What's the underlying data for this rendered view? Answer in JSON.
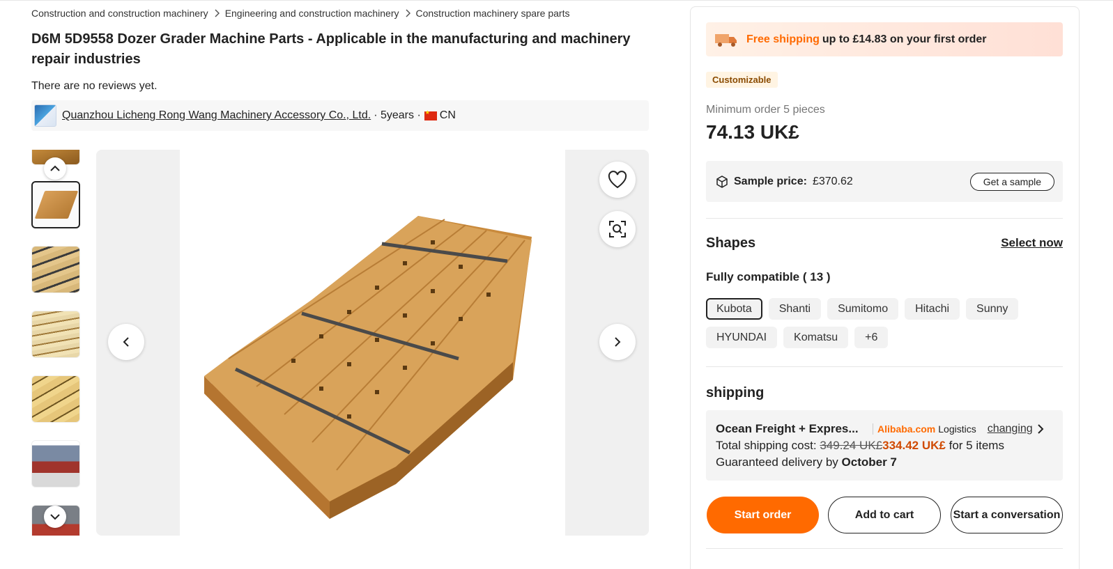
{
  "breadcrumb": {
    "items": [
      "Construction and construction machinery",
      "Engineering and construction machinery",
      "Construction machinery spare parts"
    ]
  },
  "product": {
    "title": "D6M 5D9558 Dozer Grader Machine Parts - Applicable in the manufacturing and machinery repair industries",
    "reviews": "There are no reviews yet."
  },
  "supplier": {
    "name": "Quanzhou Licheng Rong Wang Machinery Accessory Co., Ltd.",
    "years": "· 5years ·",
    "country": "CN"
  },
  "gallery": {
    "thumbnail_count": 7,
    "active_index": 1
  },
  "panel": {
    "banner_highlight": "Free shipping",
    "banner_text": "up to £14.83 on your first order",
    "badge": "Customizable",
    "min_order": "Minimum order 5 pieces",
    "price": "74.13 UK£",
    "sample_label": "Sample price:",
    "sample_price": "£370.62",
    "sample_button": "Get a sample",
    "shapes_heading": "Shapes",
    "select_now": "Select now",
    "compat_heading": "Fully compatible ( 13 )",
    "chips": [
      "Kubota",
      "Shanti",
      "Sumitomo",
      "Hitachi",
      "Sunny",
      "HYUNDAI",
      "Komatsu",
      "+6"
    ],
    "selected_chip": "Kubota",
    "shipping_heading": "shipping",
    "shipping": {
      "method": "Ocean Freight + Expres...",
      "brand_ali": "Alibaba.com",
      "brand_logistics": "Logistics",
      "changing": "changing",
      "cost_label": "Total shipping cost:",
      "old_cost": "349.24 UK£",
      "new_cost": "334.42 UK£",
      "items": "for 5 items",
      "delivery_label": "Guaranteed delivery by",
      "delivery_date": "October 7"
    },
    "buttons": {
      "start_order": "Start order",
      "add_to_cart": "Add to cart",
      "start_conversation": "Start a conversation"
    }
  },
  "colors": {
    "accent": "#ff6a00",
    "discount_price": "#d04a02",
    "badge_text": "#8a4b00"
  }
}
